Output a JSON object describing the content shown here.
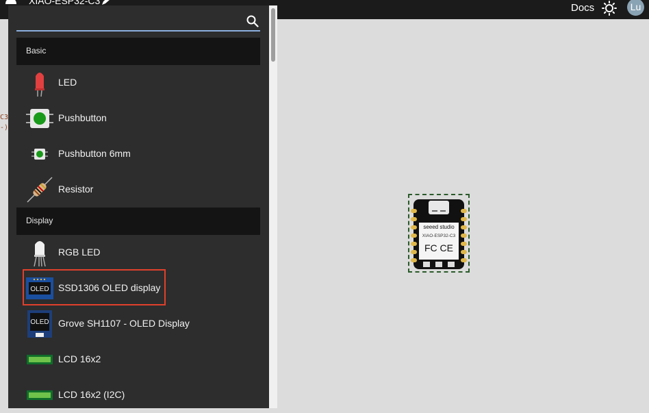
{
  "header": {
    "project_title": "XIAO-ESP32-C3",
    "docs_label": "Docs",
    "avatar_initials": "Lu"
  },
  "code_fragment": [
    "C3",
    "-)"
  ],
  "search": {
    "value": "",
    "placeholder": ""
  },
  "palette": {
    "sections": [
      {
        "title": "Basic",
        "items": [
          {
            "label": "LED",
            "icon": "led-icon"
          },
          {
            "label": "Pushbutton",
            "icon": "pushbutton-icon"
          },
          {
            "label": "Pushbutton 6mm",
            "icon": "pushbutton-6mm-icon"
          },
          {
            "label": "Resistor",
            "icon": "resistor-icon"
          }
        ]
      },
      {
        "title": "Display",
        "items": [
          {
            "label": "RGB LED",
            "icon": "rgb-led-icon"
          },
          {
            "label": "SSD1306 OLED display",
            "icon": "oled-icon",
            "highlighted": true,
            "thumb_text": "OLED"
          },
          {
            "label": "Grove SH1107 - OLED Display",
            "icon": "grove-oled-icon",
            "thumb_text": "OLED"
          },
          {
            "label": "LCD 16x2",
            "icon": "lcd-icon"
          },
          {
            "label": "LCD 16x2 (I2C)",
            "icon": "lcd-i2c-icon"
          }
        ]
      }
    ]
  },
  "board": {
    "brand": "seeed studio",
    "model": "XIAO-ESP32-C3",
    "marks": "FC CE"
  },
  "colors": {
    "highlight": "#e0402c",
    "search_underline": "#8db0e0",
    "panel": "#2d2d2d",
    "section": "#141414",
    "canvas": "#dcdcdc"
  }
}
